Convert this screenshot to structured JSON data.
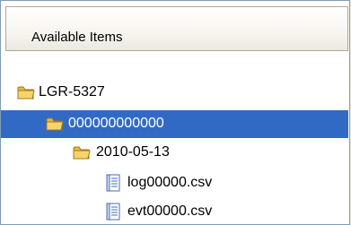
{
  "header": {
    "title": "Available Items"
  },
  "tree": {
    "root": {
      "label": "LGR-5327",
      "icon": "folder-icon"
    },
    "selected": {
      "label": "000000000000",
      "icon": "folder-icon"
    },
    "date_folder": {
      "label": "2010-05-13",
      "icon": "folder-icon"
    },
    "files": [
      {
        "label": "log00000.csv",
        "icon": "file-icon"
      },
      {
        "label": "evt00000.csv",
        "icon": "file-icon"
      }
    ]
  },
  "colors": {
    "selection": "#316ac5",
    "folder": "#f5c948",
    "border": "#7f9db9"
  }
}
